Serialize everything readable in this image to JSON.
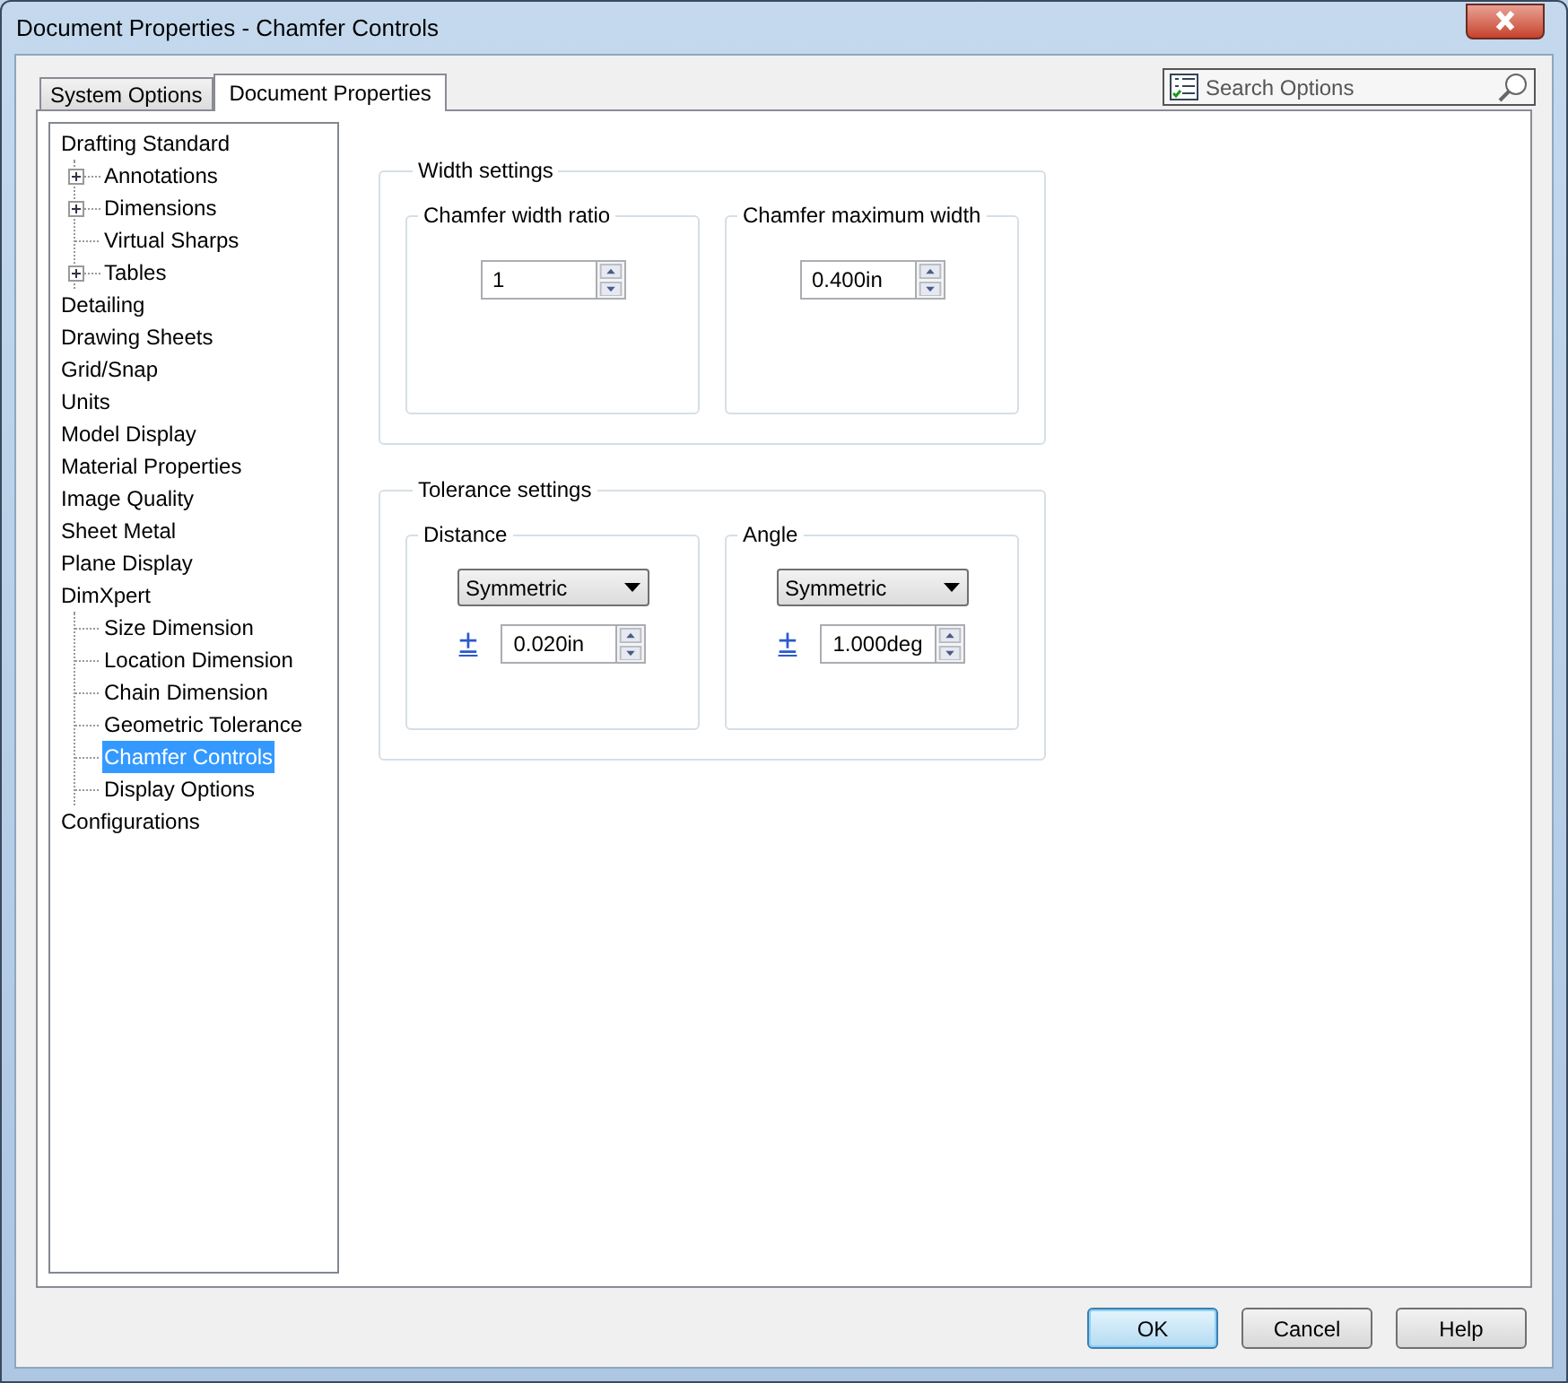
{
  "window": {
    "title": "Document Properties - Chamfer Controls"
  },
  "tabs": [
    {
      "label": "System Options",
      "selected": false
    },
    {
      "label": "Document Properties",
      "selected": true
    }
  ],
  "search": {
    "placeholder": "Search Options"
  },
  "tree": [
    {
      "label": "Drafting Standard",
      "selected": false,
      "children": [
        {
          "label": "Annotations",
          "kind": "collapsed",
          "selected": false
        },
        {
          "label": "Dimensions",
          "kind": "collapsed",
          "selected": false
        },
        {
          "label": "Virtual Sharps",
          "kind": "leaf",
          "selected": false
        },
        {
          "label": "Tables",
          "kind": "collapsed",
          "selected": false
        }
      ]
    },
    {
      "label": "Detailing",
      "selected": false
    },
    {
      "label": "Drawing Sheets",
      "selected": false
    },
    {
      "label": "Grid/Snap",
      "selected": false
    },
    {
      "label": "Units",
      "selected": false
    },
    {
      "label": "Model Display",
      "selected": false
    },
    {
      "label": "Material Properties",
      "selected": false
    },
    {
      "label": "Image Quality",
      "selected": false
    },
    {
      "label": "Sheet Metal",
      "selected": false
    },
    {
      "label": "Plane Display",
      "selected": false
    },
    {
      "label": "DimXpert",
      "selected": false,
      "children": [
        {
          "label": "Size Dimension",
          "kind": "leaf",
          "selected": false
        },
        {
          "label": "Location Dimension",
          "kind": "leaf",
          "selected": false
        },
        {
          "label": "Chain Dimension",
          "kind": "leaf",
          "selected": false
        },
        {
          "label": "Geometric Tolerance",
          "kind": "leaf",
          "selected": false
        },
        {
          "label": "Chamfer Controls",
          "kind": "leaf",
          "selected": true
        },
        {
          "label": "Display Options",
          "kind": "leaf",
          "selected": false
        }
      ]
    },
    {
      "label": "Configurations",
      "selected": false
    }
  ],
  "groups": [
    {
      "title": "Width settings",
      "subgroups": [
        {
          "title": "Chamfer width ratio",
          "value": "1"
        },
        {
          "title": "Chamfer maximum width",
          "value": "0.400in"
        }
      ]
    },
    {
      "title": "Tolerance settings",
      "subgroups": [
        {
          "title": "Distance",
          "dropdown": "Symmetric",
          "symbol": "±",
          "value": "0.020in"
        },
        {
          "title": "Angle",
          "dropdown": "Symmetric",
          "symbol": "±",
          "value": "1.000deg"
        }
      ]
    }
  ],
  "buttons": [
    {
      "label": "OK",
      "default": true
    },
    {
      "label": "Cancel",
      "default": false
    },
    {
      "label": "Help",
      "default": false
    }
  ]
}
